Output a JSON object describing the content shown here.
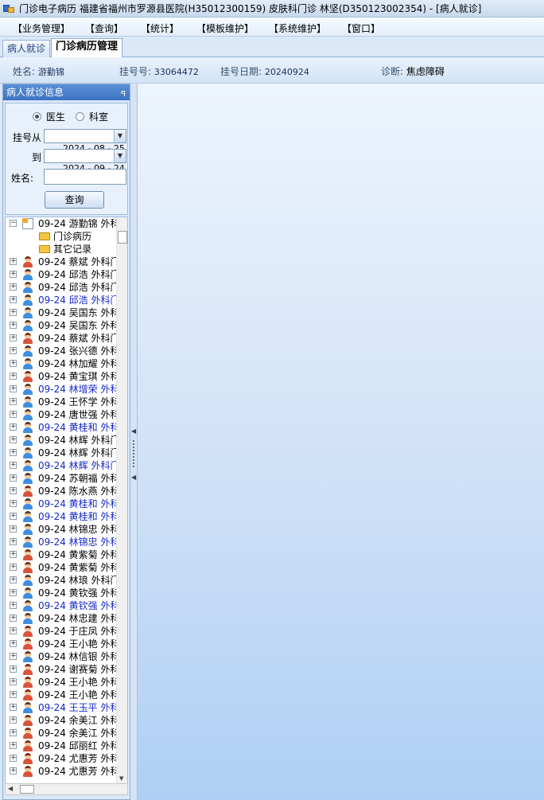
{
  "window": {
    "title": "门诊电子病历  福建省福州市罗源县医院(H35012300159)  皮肤科门诊  林坚(D350123002354) - [病人就诊]"
  },
  "menu": [
    "【业务管理】",
    "【查询】",
    "【统计】",
    "【模板维护】",
    "【系统维护】",
    "【窗口】"
  ],
  "tabs": [
    "病人就诊",
    "门诊病历管理"
  ],
  "patient": {
    "name_label": "姓名:",
    "name": "游勤锦",
    "reg_no_label": "挂号号:",
    "reg_no": "33064472",
    "reg_date_label": "挂号日期:",
    "reg_date": "20240924",
    "diagnosis_label": "诊断:",
    "diagnosis": "焦虑障碍"
  },
  "panel": {
    "title": "病人就诊信息",
    "pin_glyph": "ꟼ",
    "radio_doctor": "医生",
    "radio_dept": "科室",
    "from_label": "挂号从",
    "to_label": "到",
    "date_from": "2024 - 08 - 25",
    "date_to": "2024 - 09 - 24",
    "name_label": "姓名:",
    "name_value": "",
    "query_button": "查询"
  },
  "tree": {
    "root": "09-24  游勤锦  外科",
    "children": [
      "门诊病历",
      "其它记录"
    ],
    "rows": [
      {
        "text": "09-24  蔡斌  外科门",
        "gender": "female",
        "blue": false
      },
      {
        "text": "09-24  邱浩  外科门",
        "gender": "male",
        "blue": false
      },
      {
        "text": "09-24  邱浩  外科门",
        "gender": "male",
        "blue": false
      },
      {
        "text": "09-24  邱浩  外科门",
        "gender": "male",
        "blue": true
      },
      {
        "text": "09-24  吴国东  外科",
        "gender": "male",
        "blue": false
      },
      {
        "text": "09-24  吴国东  外科",
        "gender": "male",
        "blue": false
      },
      {
        "text": "09-24  蔡斌  外科门",
        "gender": "female",
        "blue": false
      },
      {
        "text": "09-24  张兴德  外科",
        "gender": "male",
        "blue": false
      },
      {
        "text": "09-24  林加耀  外科",
        "gender": "male",
        "blue": false
      },
      {
        "text": "09-24  黄宝琪  外科",
        "gender": "female",
        "blue": false
      },
      {
        "text": "09-24  林增荣  外科",
        "gender": "male",
        "blue": true
      },
      {
        "text": "09-24  王怀学  外科",
        "gender": "male",
        "blue": false
      },
      {
        "text": "09-24  唐世强  外科",
        "gender": "male",
        "blue": false
      },
      {
        "text": "09-24  黄桂和  外科",
        "gender": "male",
        "blue": true
      },
      {
        "text": "09-24  林辉  外科门",
        "gender": "male",
        "blue": false
      },
      {
        "text": "09-24  林辉  外科门",
        "gender": "male",
        "blue": false
      },
      {
        "text": "09-24  林辉  外科门",
        "gender": "male",
        "blue": true
      },
      {
        "text": "09-24  苏朝福  外科",
        "gender": "male",
        "blue": false
      },
      {
        "text": "09-24  陈水燕  外科",
        "gender": "female",
        "blue": false
      },
      {
        "text": "09-24  黄桂和  外科",
        "gender": "male",
        "blue": true
      },
      {
        "text": "09-24  黄桂和  外科",
        "gender": "male",
        "blue": true
      },
      {
        "text": "09-24  林锦忠  外科",
        "gender": "male",
        "blue": false
      },
      {
        "text": "09-24  林锦忠  外科",
        "gender": "male",
        "blue": true
      },
      {
        "text": "09-24  黄紫菊  外科",
        "gender": "female",
        "blue": false
      },
      {
        "text": "09-24  黄紫菊  外科",
        "gender": "female",
        "blue": false
      },
      {
        "text": "09-24  林琅  外科门",
        "gender": "male",
        "blue": false
      },
      {
        "text": "09-24  黄钦强  外科",
        "gender": "male",
        "blue": false
      },
      {
        "text": "09-24  黄钦强  外科",
        "gender": "male",
        "blue": true
      },
      {
        "text": "09-24  林忠建  外科",
        "gender": "male",
        "blue": false
      },
      {
        "text": "09-24  于庄凤  外科",
        "gender": "female",
        "blue": false
      },
      {
        "text": "09-24  王小艳  外科",
        "gender": "female",
        "blue": false
      },
      {
        "text": "09-24  林信银  外科",
        "gender": "male",
        "blue": false
      },
      {
        "text": "09-24  谢赛菊  外科",
        "gender": "female",
        "blue": false
      },
      {
        "text": "09-24  王小艳  外科",
        "gender": "female",
        "blue": false
      },
      {
        "text": "09-24  王小艳  外科",
        "gender": "female",
        "blue": false
      },
      {
        "text": "09-24  王玉平  外科",
        "gender": "male",
        "blue": true
      },
      {
        "text": "09-24  余美江  外科",
        "gender": "female",
        "blue": false
      },
      {
        "text": "09-24  余美江  外科",
        "gender": "female",
        "blue": false
      },
      {
        "text": "09-24  邱丽红  外科",
        "gender": "female",
        "blue": false
      },
      {
        "text": "09-24  尤惠芳  外科",
        "gender": "female",
        "blue": false
      },
      {
        "text": "09-24  尤惠芳  外科",
        "gender": "female",
        "blue": false
      }
    ]
  },
  "colors": {
    "accent": "#3d72c2",
    "link_blue": "#1529c8"
  }
}
